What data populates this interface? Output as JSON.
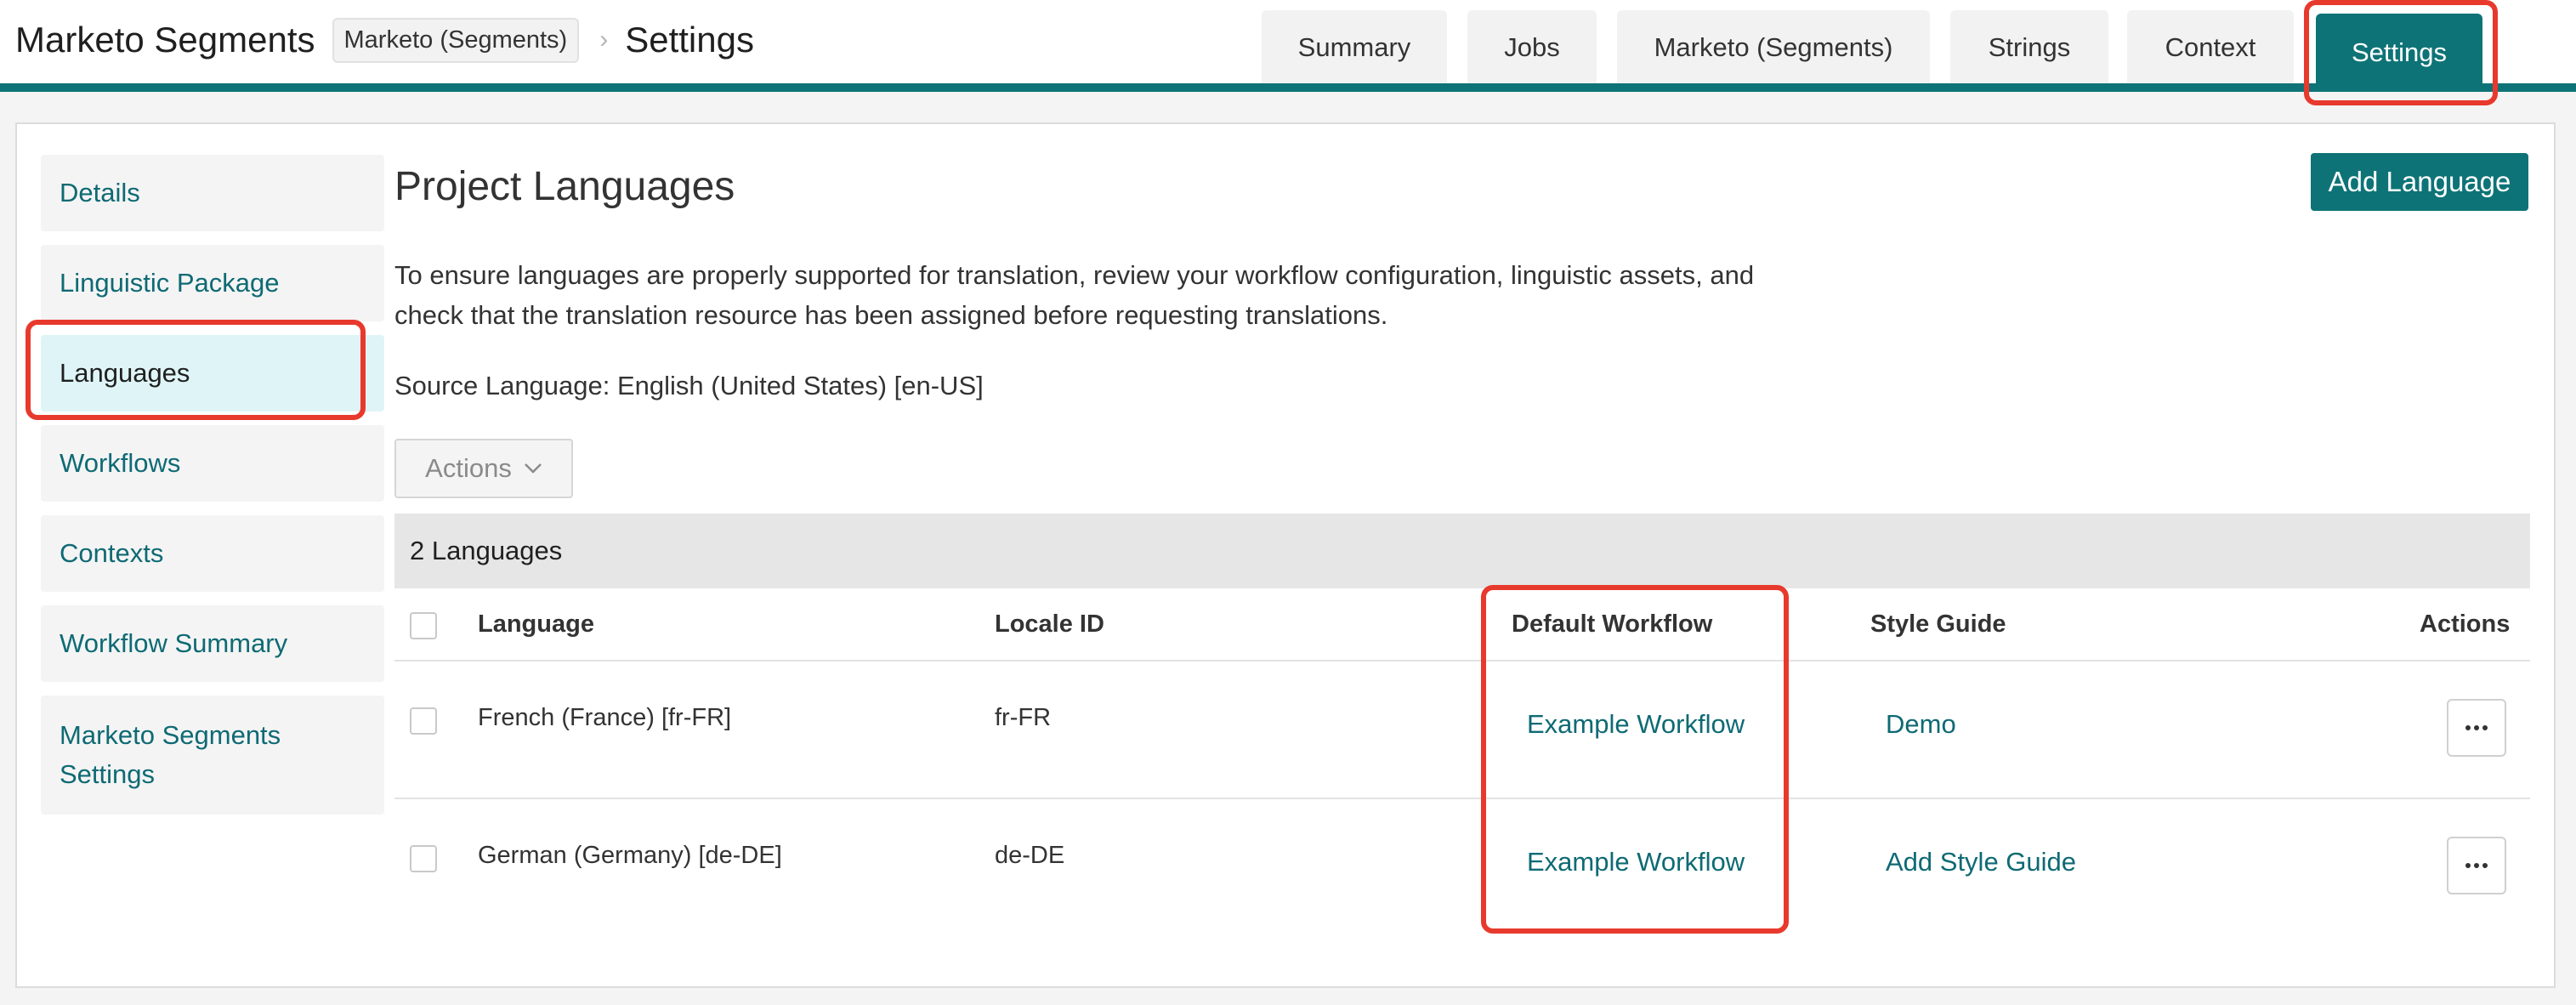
{
  "header": {
    "project_title": "Marketo Segments",
    "breadcrumb_chip": "Marketo (Segments)",
    "breadcrumb_separator": "›",
    "page_title": "Settings"
  },
  "tabs": [
    {
      "label": "Summary",
      "active": false
    },
    {
      "label": "Jobs",
      "active": false
    },
    {
      "label": "Marketo (Segments)",
      "active": false
    },
    {
      "label": "Strings",
      "active": false
    },
    {
      "label": "Context",
      "active": false
    },
    {
      "label": "Settings",
      "active": true
    }
  ],
  "sidebar": {
    "items": [
      {
        "label": "Details",
        "active": false
      },
      {
        "label": "Linguistic Package",
        "active": false
      },
      {
        "label": "Languages",
        "active": true
      },
      {
        "label": "Workflows",
        "active": false
      },
      {
        "label": "Contexts",
        "active": false
      },
      {
        "label": "Workflow Summary",
        "active": false
      },
      {
        "label": "Marketo Segments Settings",
        "active": false
      }
    ]
  },
  "main": {
    "title": "Project Languages",
    "add_button": "Add Language",
    "intro_line1": "To ensure languages are properly supported for translation, review your workflow configuration, linguistic assets, and",
    "intro_line2": "check that the translation resource has been assigned before requesting translations.",
    "source_language": "Source Language: English (United States) [en-US]",
    "actions_dropdown": "Actions",
    "table": {
      "count_label": "2 Languages",
      "columns": [
        "Language",
        "Locale ID",
        "Default Workflow",
        "Style Guide",
        "Actions"
      ],
      "rows": [
        {
          "language": "French (France) [fr-FR]",
          "locale": "fr-FR",
          "workflow": "Example Workflow",
          "style_guide": "Demo"
        },
        {
          "language": "German (Germany) [de-DE]",
          "locale": "de-DE",
          "workflow": "Example Workflow",
          "style_guide": "Add Style Guide"
        }
      ]
    }
  },
  "colors": {
    "accent": "#0e7377",
    "link": "#0e6a74",
    "highlight": "#e8392d",
    "active_nav_bg": "#dff4f6"
  },
  "icons": {
    "breadcrumb_separator": "chevron-right-icon",
    "dropdown": "chevron-down-icon",
    "row_menu": "more-horizontal-icon"
  }
}
